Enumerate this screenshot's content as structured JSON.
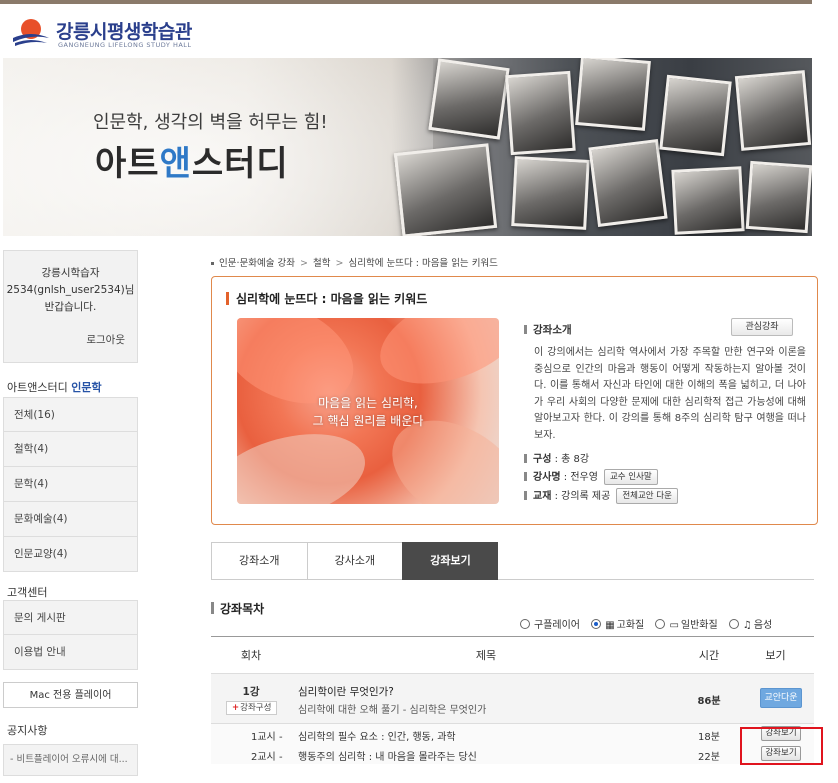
{
  "logo": {
    "name_ko": "강릉시평생학습관",
    "name_en": "GANGNEUNG LIFELONG STUDY HALL"
  },
  "banner": {
    "subtitle": "인문학, 생각의 벽을 허무는 힘!",
    "title_a": "아트",
    "title_b": "앤",
    "title_c": "스터디"
  },
  "sidebar": {
    "user_line1": "강릉시학습자",
    "user_line2": "2534(gnlsh_user2534)님",
    "user_line3": "반갑습니다.",
    "logout": "로그아웃",
    "category_prefix": "아트앤스터디",
    "category_name": "인문학",
    "categories": [
      "전체(16)",
      "철학(4)",
      "문학(4)",
      "문화예술(4)",
      "인문교양(4)"
    ],
    "support_heading": "고객센터",
    "support_items": [
      "문의 게시판",
      "이용법 안내"
    ],
    "mac_player": "Mac 전용 플레이어",
    "notice_heading": "공지사항",
    "notice_item": "- 비트플레이어 오류시에 대..."
  },
  "breadcrumb": {
    "c1": "인문·문화예술 강좌",
    "c2": "철학",
    "c3": "심리학에 눈뜨다 : 마음을 읽는 키워드",
    "sep": ">"
  },
  "course": {
    "title": "심리학에 눈뜨다 : 마음을 읽는 키워드",
    "image_caption_1": "마음을 읽는 심리학,",
    "image_caption_2": "그 핵심 원리를 배운다",
    "intro_heading": "강좌소개",
    "favorite_button": "관심강좌",
    "description": "이 강의에서는 심리학 역사에서 가장 주목할 만한 연구와 이론을 중심으로 인간의 마음과 행동이 어떻게 작동하는지 알아볼 것이다. 이를 통해서 자신과 타인에 대한 이해의 폭을 넓히고, 더 나아가 우리 사회의 다양한 문제에 대한 심리학적 접근 가능성에 대해 알아보고자 한다. 이 강의를 통해 8주의 심리학 탐구 여행을 떠나보자.",
    "composition_label": "구성",
    "composition_value": " : 총 8강",
    "instructor_label": "강사명",
    "instructor_value": " : 전우영",
    "instructor_button": "교수 인사말",
    "material_label": "교재",
    "material_value": " : 강의록 제공",
    "material_button": "전체교안 다운"
  },
  "tabs": [
    "강좌소개",
    "강사소개",
    "강좌보기"
  ],
  "toc": {
    "heading": "강좌목차",
    "quality_options": [
      "구플레이어",
      "고화질",
      "일반화질",
      "음성"
    ],
    "quality_selected": "고화질",
    "columns": [
      "회차",
      "제목",
      "시간",
      "보기"
    ],
    "lecture": {
      "num": "1강",
      "tag": "강좌구성",
      "title": "심리학이란 무엇인가?",
      "subtitle": "심리학에 대한 오해 풀기 - 심리학은 무엇인가",
      "time": "86분",
      "download": "교안다운"
    },
    "lessons": [
      {
        "num": "1교시 -",
        "title": "심리학의 필수 요소 : 인간, 행동, 과학",
        "time": "18분",
        "button": "강좌보기"
      },
      {
        "num": "2교시 -",
        "title": "행동주의 심리학 : 내 마음을 몰라주는 당신",
        "time": "22분",
        "button": "강좌보기"
      }
    ]
  }
}
